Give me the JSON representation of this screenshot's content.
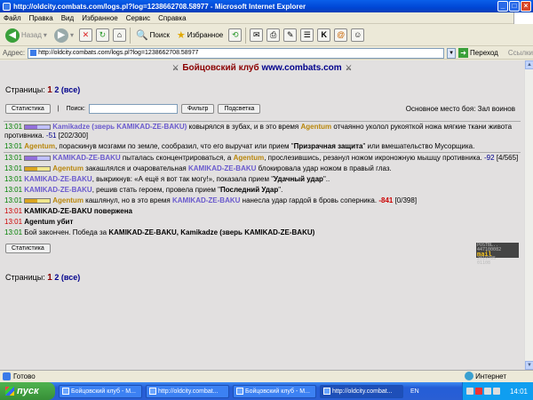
{
  "window": {
    "title": "http://oldcity.combats.com/logs.pl?log=1238662708.58977 - Microsoft Internet Explorer"
  },
  "menu": [
    "Файл",
    "Правка",
    "Вид",
    "Избранное",
    "Сервис",
    "Справка"
  ],
  "toolbar": {
    "back": "Назад",
    "search": "Поиск",
    "favorites": "Избранное"
  },
  "address": {
    "label": "Адрес:",
    "url": "http://oldcity.combats.com/logs.pl?log=1238662708.58977",
    "go": "Переход",
    "links": "Ссылки"
  },
  "page": {
    "title_prefix": "Бойцовский клуб",
    "title_site": "www.combats.com",
    "pages_label": "Страницы:",
    "page_current": "1",
    "page_next": "2",
    "page_all": "(все)",
    "stats_button": "Статистика",
    "search_label": "Поиск:",
    "search_value": "",
    "filter_button": "Фильтр",
    "highlight_button": "Подсветка",
    "location": "Основное место боя: Зал воинов"
  },
  "log": [
    {
      "time": "13:01",
      "actor": "Kamikadze (зверь KAMIKAD-ZE-BAKU)",
      "text": " ковырялся в зубах, и в это время ",
      "target": "Agentum",
      "text2": " отчаянно уколол рукояткой ножа мягкие ткани живота противника. ",
      "dmg": "-51",
      "hp": "[202/300]"
    },
    {
      "time": "13:01",
      "actor": "Agentum",
      "text": ", пораскинув мозгами по земле, сообразил, что его выручат или прием \"",
      "skill": "Призрачная защита",
      "text2": "\" или вмешательство Мусорщика."
    },
    {
      "time": "13:01",
      "actor": "KAMIKAD-ZE-BAKU",
      "text": " пыталась сконцентрироваться, а ",
      "target": "Agentum",
      "text2": ", прослезившись, резанул ножом икроножную мышцу противника. ",
      "dmg": "-92",
      "hp": "[4/565]"
    },
    {
      "time": "13:01",
      "actor": "Agentum",
      "text": " закашлялся и очаровательная ",
      "target": "KAMIKAD-ZE-BAKU",
      "text2": " блокировала удар ножом в правый глаз."
    },
    {
      "time": "13:01",
      "actor": "KAMIKAD-ZE-BAKU",
      "text": ", выкрикнув: «А ещё я вот так могу!», показала прием \"",
      "skill": "Удачный удар",
      "text2": "\".."
    },
    {
      "time": "13:01",
      "actor": "KAMIKAD-ZE-BAKU",
      "text": ", решив стать героем, провела прием \"",
      "skill": "Последний Удар",
      "text2": "\"."
    },
    {
      "time": "13:01",
      "actor": "Agentum",
      "text": " кашлянул, но в это время ",
      "target": "KAMIKAD-ZE-BAKU",
      "text2": " нанесла удар гардой в бровь соперника. ",
      "dmg": "-841",
      "hp": "[0/398]"
    },
    {
      "time": "13:01",
      "text": "KAMIKAD-ZE-BAKU повержена"
    },
    {
      "time": "13:01",
      "text": "Agentum убит"
    },
    {
      "time": "13:01",
      "text": "Бой закончен. Победа за ",
      "winners": "KAMIKAD-ZE-BAKU, Kamikadze (зверь KAMIKAD-ZE-BAKU)"
    }
  ],
  "counter": {
    "line1": "POSTBL.. 447100082",
    "mail": "mail",
    "line2": "2019705",
    "line3": "01108"
  },
  "status": {
    "ready": "Готово",
    "zone": "Интернет"
  },
  "taskbar": {
    "start": "пуск",
    "tasks": [
      "Бойцовский клуб - M...",
      "http://oldcity.combat...",
      "Бойцовский клуб - M...",
      "http://oldcity.combat..."
    ],
    "lang": "EN",
    "clock": "14:01"
  }
}
